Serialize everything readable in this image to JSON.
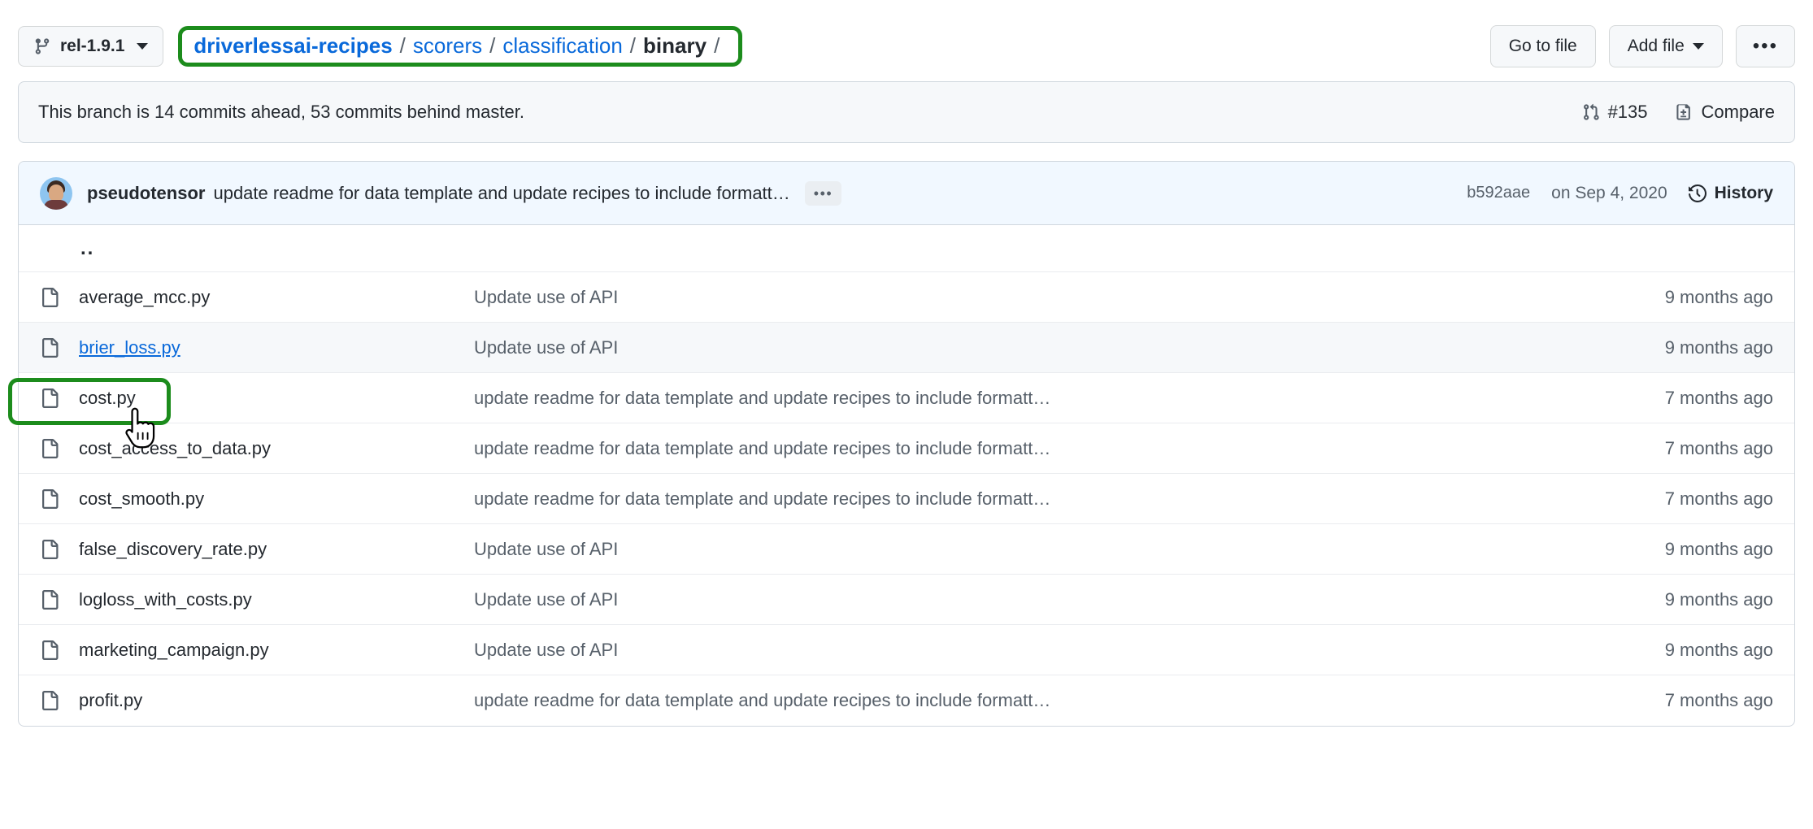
{
  "header": {
    "branch_selector": {
      "label": "rel-1.9.1",
      "icon": "git-branch-icon"
    },
    "breadcrumb": {
      "repo": "driverlessai-recipes",
      "separator": "/",
      "parts": [
        "scorers",
        "classification"
      ],
      "current": "binary",
      "trailing_separator": "/"
    },
    "actions": {
      "go_to_file": "Go to file",
      "add_file": "Add file",
      "more": "•••"
    }
  },
  "branch_status": {
    "message": "This branch is 14 commits ahead, 53 commits behind master.",
    "pull_request": "#135",
    "compare": "Compare"
  },
  "latest_commit": {
    "author": "pseudotensor",
    "message": "update readme for data template and update recipes to include formatt…",
    "expand_button": "•••",
    "sha": "b592aae",
    "date": "on Sep 4, 2020",
    "history": "History"
  },
  "file_list": {
    "parent_dir": "..",
    "rows": [
      {
        "name": "average_mcc.py",
        "message": "Update use of API",
        "age": "9 months ago",
        "hovered": false
      },
      {
        "name": "brier_loss.py",
        "message": "Update use of API",
        "age": "9 months ago",
        "hovered": true
      },
      {
        "name": "cost.py",
        "message": "update readme for data template and update recipes to include formatt…",
        "age": "7 months ago",
        "hovered": false
      },
      {
        "name": "cost_access_to_data.py",
        "message": "update readme for data template and update recipes to include formatt…",
        "age": "7 months ago",
        "hovered": false
      },
      {
        "name": "cost_smooth.py",
        "message": "update readme for data template and update recipes to include formatt…",
        "age": "7 months ago",
        "hovered": false
      },
      {
        "name": "false_discovery_rate.py",
        "message": "Update use of API",
        "age": "9 months ago",
        "hovered": false
      },
      {
        "name": "logloss_with_costs.py",
        "message": "Update use of API",
        "age": "9 months ago",
        "hovered": false
      },
      {
        "name": "marketing_campaign.py",
        "message": "Update use of API",
        "age": "9 months ago",
        "hovered": false
      },
      {
        "name": "profit.py",
        "message": "update readme for data template and update recipes to include formatt…",
        "age": "7 months ago",
        "hovered": false
      }
    ]
  },
  "annotations": {
    "highlight_color": "#1c8c1c",
    "targets": [
      "breadcrumb",
      "brier_loss.py"
    ]
  },
  "colors": {
    "link": "#0969da",
    "text": "#24292f",
    "muted": "#57606a",
    "border": "#d0d7de",
    "surface": "#f6f8fa",
    "commit_bar": "#f1f8ff"
  }
}
